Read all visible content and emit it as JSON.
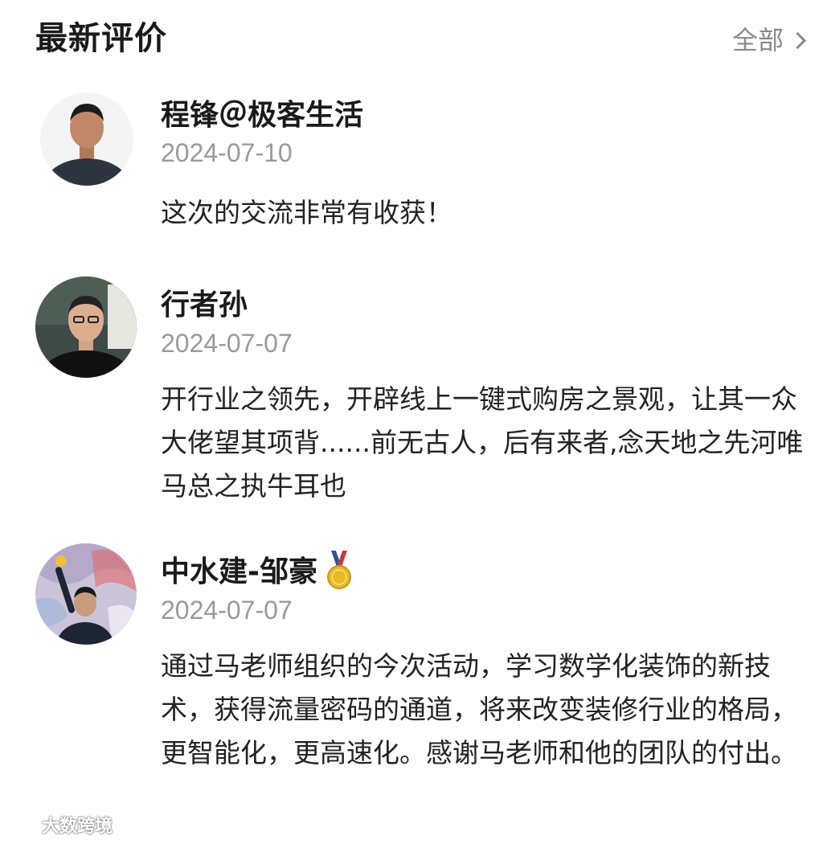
{
  "header": {
    "title": "最新评价",
    "all_label": "全部"
  },
  "reviews": [
    {
      "author": "程锋＠极客生活",
      "date": "2024-07-10",
      "content": "这次的交流非常有收获！",
      "avatar_bg": "#f2f2f2"
    },
    {
      "author": "行者孙",
      "date": "2024-07-07",
      "content": "开行业之领先，开辟线上一键式购房之景观，让其一众大佬望其项背......前无古人，后有来者,念天地之先河唯马总之执牛耳也",
      "avatar_bg": "#3d4a45"
    },
    {
      "author": "中水建-邹豪",
      "date": "2024-07-07",
      "content": "通过马老师组织的今次活动，学习数学化装饰的新技术，获得流量密码的通道，将来改变装修行业的格局，更智能化，更高速化。感谢马老师和他的团队的付出。",
      "avatar_bg": "#c9c2d6",
      "badge": "medal-icon"
    }
  ],
  "watermark": {
    "text": "大数跨境"
  },
  "colors": {
    "title": "#1a1a1a",
    "muted": "#9a9a9a",
    "body": "#222222",
    "medal_gold": "#e8b923"
  }
}
